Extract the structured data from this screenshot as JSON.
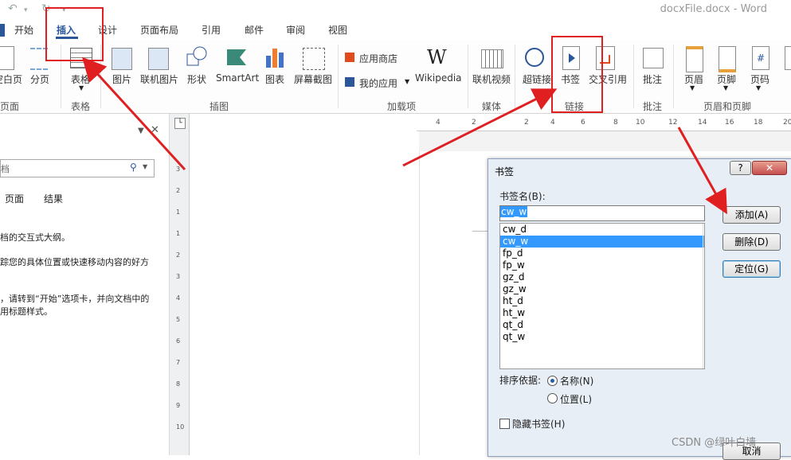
{
  "app": {
    "title": "docxFile.docx - Word",
    "qat_undo": "↶",
    "qat_redo": "↻"
  },
  "tabs": [
    "开始",
    "插入",
    "设计",
    "页面布局",
    "引用",
    "邮件",
    "审阅",
    "视图"
  ],
  "ribbon": {
    "pages_group": {
      "blank_page": "空白页",
      "page_break": "分页",
      "label": "页面"
    },
    "table_group": {
      "table": "表格",
      "label": "表格"
    },
    "illustrations_group": {
      "picture": "图片",
      "online_picture": "联机图片",
      "shapes": "形状",
      "smartart": "SmartArt",
      "chart": "图表",
      "screenshot": "屏幕截图",
      "label": "插图"
    },
    "addins_group": {
      "app_store": "应用商店",
      "my_apps": "我的应用",
      "wikipedia": "Wikipedia",
      "label": "加载项"
    },
    "media_group": {
      "online_video": "联机视频",
      "label": "媒体"
    },
    "links_group": {
      "hyperlink": "超链接",
      "bookmark": "书签",
      "cross_reference": "交叉引用",
      "label": "链接"
    },
    "comments_group": {
      "comment": "批注",
      "label": "批注"
    },
    "header_footer_group": {
      "header": "页眉",
      "footer": "页脚",
      "page_number": "页码",
      "label": "页眉和页脚"
    }
  },
  "nav_pane": {
    "search_placeholder": "档",
    "tabs": [
      "页面",
      "结果"
    ],
    "text_1": "档的交互式大纲。",
    "text_2": "踪您的具体位置或快速移动内容的好方",
    "text_3": "，请转到“开始”选项卡，并向文档中的",
    "text_4": "用标题样式。"
  },
  "ruler_ticks": [
    "4",
    "2",
    "2",
    "4",
    "6",
    "8",
    "10",
    "12",
    "14",
    "16",
    "18",
    "20"
  ],
  "vruler_ticks": [
    "3",
    "2",
    "1",
    "1",
    "2",
    "3",
    "4",
    "5",
    "6",
    "7",
    "8",
    "9",
    "10"
  ],
  "dialog": {
    "title": "书签",
    "help": "?",
    "close": "✕",
    "name_label": "书签名(B):",
    "name_value": "cw_w",
    "bookmarks": [
      "cw_d",
      "cw_w",
      "fp_d",
      "fp_w",
      "gz_d",
      "gz_w",
      "ht_d",
      "ht_w",
      "qt_d",
      "qt_w"
    ],
    "selected_index": 1,
    "add": "添加(A)",
    "delete": "删除(D)",
    "goto": "定位(G)",
    "sort_label": "排序依据:",
    "sort_name": "名称(N)",
    "sort_location": "位置(L)",
    "hidden_label": "隐藏书签(H)",
    "cancel": "取消"
  },
  "watermark": "CSDN @绿叶白墙",
  "colors": {
    "accent": "#2b579a",
    "annotation": "#e02020",
    "selection": "#3399ff"
  }
}
